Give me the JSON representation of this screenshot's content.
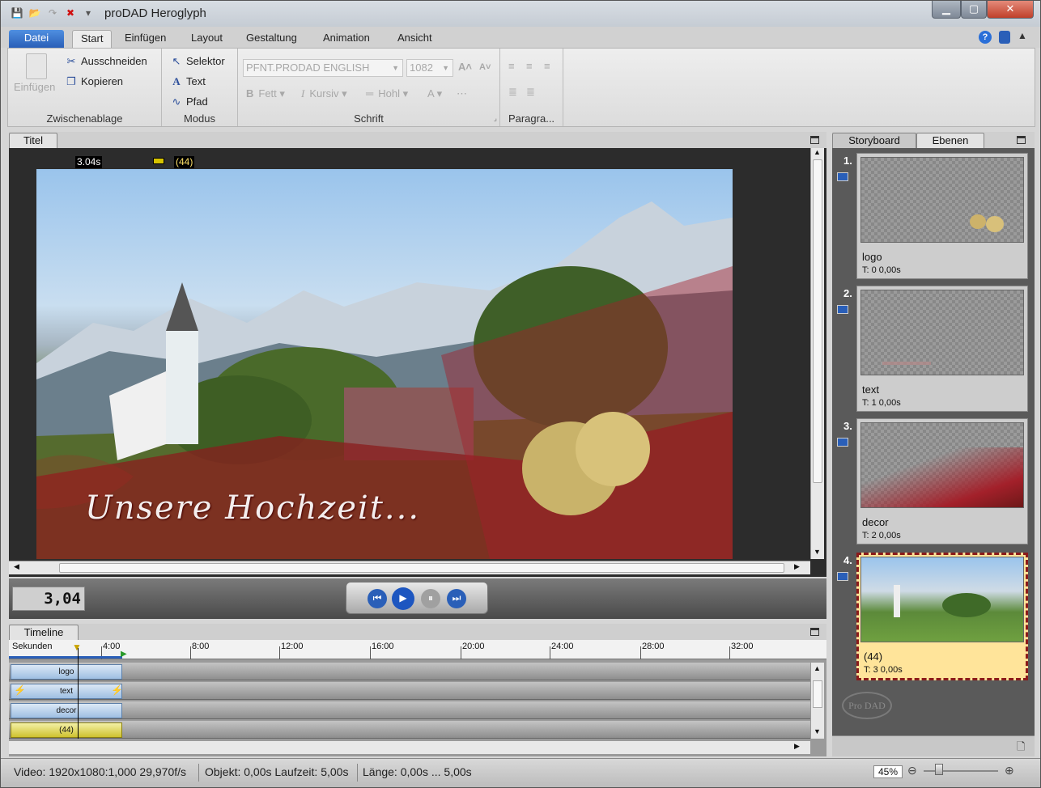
{
  "window": {
    "title": "proDAD Heroglyph",
    "minimize": "▁",
    "maximize": "▢",
    "close": "✕"
  },
  "quickaccess": {
    "save": "💾",
    "open": "📂",
    "redo": "↷",
    "delete": "✖",
    "more": "▾"
  },
  "tabs": [
    {
      "label": "Datei"
    },
    {
      "label": "Start"
    },
    {
      "label": "Einfügen"
    },
    {
      "label": "Layout"
    },
    {
      "label": "Gestaltung"
    },
    {
      "label": "Animation"
    },
    {
      "label": "Ansicht"
    }
  ],
  "ribbon": {
    "clipboard": {
      "label": "Zwischenablage",
      "paste": "Einfügen",
      "cut": "Ausschneiden",
      "copy": "Kopieren"
    },
    "mode": {
      "label": "Modus",
      "selector": "Selektor",
      "text": "Text",
      "path": "Pfad"
    },
    "font": {
      "label": "Schrift",
      "family": "PFNT.PRODAD ENGLISH",
      "size": "1082",
      "bold": "Fett",
      "italic": "Kursiv",
      "hollow": "Hohl"
    },
    "paragraph": {
      "label": "Paragra..."
    }
  },
  "viewer": {
    "tab": "Titel",
    "time": "3.04s",
    "frame": "(44)",
    "caption": "Unsere  Hochzeit..."
  },
  "transport": {
    "timecode": "3,04"
  },
  "timeline": {
    "tab": "Timeline",
    "unit": "Sekunden",
    "ticks": [
      "4:00",
      "8:00",
      "12:00",
      "16:00",
      "20:00",
      "24:00",
      "28:00",
      "32:00"
    ],
    "tracks": [
      {
        "label": "logo"
      },
      {
        "label": "text"
      },
      {
        "label": "decor"
      },
      {
        "label": "(44)"
      }
    ]
  },
  "rightpanel": {
    "tabs": [
      {
        "label": "Storyboard"
      },
      {
        "label": "Ebenen"
      }
    ],
    "layers": [
      {
        "num": "1.",
        "name": "logo",
        "time": "T: 0  0,00s"
      },
      {
        "num": "2.",
        "name": "text",
        "time": "T: 1  0,00s"
      },
      {
        "num": "3.",
        "name": "decor",
        "time": "T: 2  0,00s"
      },
      {
        "num": "4.",
        "name": "(44)",
        "time": "T: 3  0,00s"
      }
    ],
    "logo": "Pro DAD"
  },
  "status": {
    "video": "Video: 1920x1080:1,000  29,970f/s",
    "object": "Objekt: 0,00s  Laufzeit: 5,00s",
    "length": "Länge: 0,00s ... 5,00s",
    "zoom": "45%"
  }
}
